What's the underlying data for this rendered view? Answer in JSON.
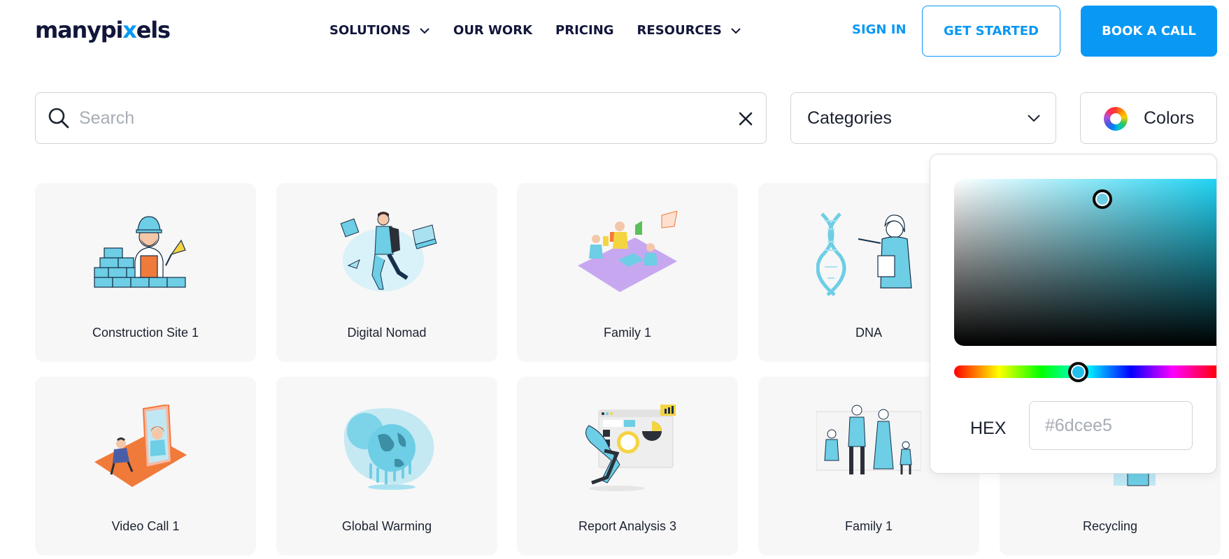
{
  "header": {
    "logo_text": "manypi",
    "logo_dot": "x",
    "logo_tail": "els",
    "nav": [
      {
        "label": "SOLUTIONS",
        "dropdown": true
      },
      {
        "label": "OUR WORK",
        "dropdown": false
      },
      {
        "label": "PRICING",
        "dropdown": false
      },
      {
        "label": "RESOURCES",
        "dropdown": true
      }
    ],
    "sign_in": "SIGN IN",
    "get_started": "GET STARTED",
    "book_call": "BOOK A CALL"
  },
  "filters": {
    "search_placeholder": "Search",
    "search_value": "",
    "categories_label": "Categories",
    "colors_label": "Colors"
  },
  "cards": [
    {
      "title": "Construction Site 1",
      "icon": "construction-worker-illustration"
    },
    {
      "title": "Digital Nomad",
      "icon": "digital-nomad-illustration"
    },
    {
      "title": "Family 1",
      "icon": "family-picnic-illustration"
    },
    {
      "title": "DNA",
      "icon": "dna-scientist-illustration"
    },
    {
      "title": "Video Call 1",
      "icon": "video-call-illustration"
    },
    {
      "title": "Global Warming",
      "icon": "melting-globe-illustration"
    },
    {
      "title": "Report Analysis 3",
      "icon": "report-analysis-illustration"
    },
    {
      "title": "Family 1",
      "icon": "family-portrait-illustration"
    },
    {
      "title": "Recycling",
      "icon": "recycling-illustration"
    }
  ],
  "color_picker": {
    "hex_label": "HEX",
    "hex_placeholder": "#6dcee5",
    "selected_color": "#6dcee5",
    "hue_color": "#1fd3f3"
  },
  "colors": {
    "brand_blue": "#0a98f5",
    "brand_navy": "#11163a",
    "card_bg": "#f7f7f7",
    "illustration_blue": "#6dcee5"
  }
}
